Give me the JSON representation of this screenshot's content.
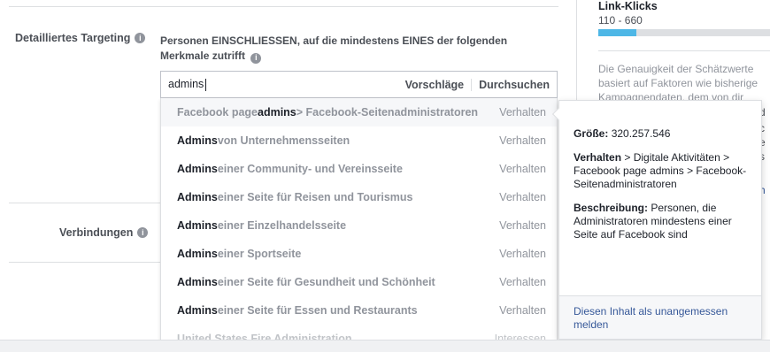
{
  "targeting": {
    "label": "Detailliertes Targeting",
    "description": "Personen EINSCHLIESSEN, auf die mindestens EINES der folgenden Merkmale zutrifft"
  },
  "connections": {
    "label": "Verbindungen"
  },
  "search": {
    "value": "admins",
    "suggestions_label": "Vorschläge",
    "browse_label": "Durchsuchen"
  },
  "results": [
    {
      "pre": "Facebook page ",
      "mid": "admins",
      "rest": " > Facebook-Seitenadministratoren",
      "category": "Verhalten"
    },
    {
      "pre": "Admins",
      "rest": " von Unternehmensseiten",
      "category": "Verhalten"
    },
    {
      "pre": "Admins",
      "rest": " einer Community- und Vereinsseite",
      "category": "Verhalten"
    },
    {
      "pre": "Admins",
      "rest": " einer Seite für Reisen und Tourismus",
      "category": "Verhalten"
    },
    {
      "pre": "Admins",
      "rest": " einer Einzelhandelsseite",
      "category": "Verhalten"
    },
    {
      "pre": "Admins",
      "rest": " einer Sportseite",
      "category": "Verhalten"
    },
    {
      "pre": "Admins",
      "rest": " einer Seite für Gesundheit und Schönheit",
      "category": "Verhalten"
    },
    {
      "pre": "Admins",
      "rest": " einer Seite für Essen und Restaurants",
      "category": "Verhalten"
    },
    {
      "pre": "United States Fire Administration",
      "rest": "",
      "category": "Interessen"
    }
  ],
  "side": {
    "metric_title": "Link-Klicks",
    "metric_range": "110 - 660",
    "metric_fill": 0.22,
    "note": "Die Genauigkeit der Schätzwerte basiert auf Faktoren wie bisherige Kampagnendaten, dem von dir"
  },
  "tooltip": {
    "size_label": "Größe:",
    "size_value": "320.257.546",
    "path_label": "Verhalten",
    "path_value": " > Digitale Aktivitäten > Facebook page admins > Facebook-Seitenadministratoren",
    "desc_label": "Beschreibung:",
    "desc_value": " Personen, die Administratoren mindestens einer Seite auf Facebook sind",
    "report_link": "Diesen Inhalt als unangemessen melden"
  },
  "colors": {
    "accent": "#4eb7e6",
    "link": "#365899",
    "muted": "#90949c"
  }
}
